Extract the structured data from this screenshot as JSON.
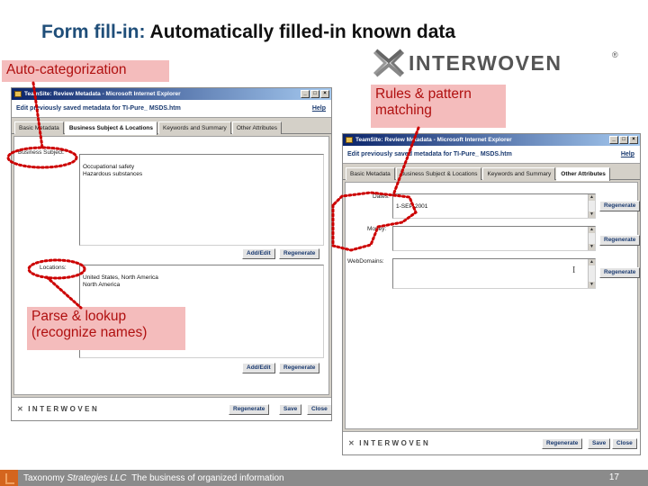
{
  "slide": {
    "title_prefix": "Form fill-in:",
    "title_rest": " Automatically filled-in known data",
    "logo_text": "INTERWOVEN",
    "logo_tm": "®"
  },
  "callouts": {
    "auto_categorization": "Auto-categorization",
    "rules_pattern": "Rules & pattern\nmatching",
    "parse_lookup": "Parse & lookup\n(recognize names)"
  },
  "window1": {
    "title": "TeamSite: Review Metadata - Microsoft Internet Explorer",
    "header": "Edit previously saved metadata for TI-Pure_ MSDS.htm",
    "help": "Help",
    "tabs": [
      "Basic Metadata",
      "Business Subject & Locations",
      "Keywords and Summary",
      "Other Attributes"
    ],
    "active_tab": 1,
    "business_subject_label": "Business Subject:",
    "business_subject_value": "Occupational safety\nHazardous substances",
    "locations_label": "Locations:",
    "locations_value": "United States, North America\nNorth America",
    "add_edit": "Add/Edit",
    "regenerate": "Regenerate",
    "footer_logo": "INTERWOVEN",
    "footer_buttons": [
      "Regenerate",
      "Save",
      "Close"
    ]
  },
  "window2": {
    "title": "TeamSite: Review Metadata - Microsoft Internet Explorer",
    "header": "Edit previously saved metadata for TI-Pure_ MSDS.htm",
    "help": "Help",
    "tabs": [
      "Basic Metadata",
      "Business Subject & Locations",
      "Keywords and Summary",
      "Other Attributes"
    ],
    "active_tab": 3,
    "dates_label": "Dates:",
    "dates_value": "1-SEP-2001",
    "money_label": "Money:",
    "money_value": "",
    "webdomains_label": "WebDomains:",
    "webdomains_value": "",
    "regenerate": "Regenerate",
    "footer_logo": "INTERWOVEN",
    "footer_buttons": [
      "Regenerate",
      "Save",
      "Close"
    ]
  },
  "footer": {
    "company": "Taxonomy",
    "company_italic": "Strategies LLC",
    "tagline": "The business of organized information",
    "page_number": "17"
  },
  "colors": {
    "callout_bg": "#f4bcbc",
    "callout_text": "#b01010",
    "annotation_red": "#cc0000",
    "title_blue": "#1f4e79",
    "footer_gray": "#8b8b8b",
    "footer_orange": "#d4651e"
  }
}
